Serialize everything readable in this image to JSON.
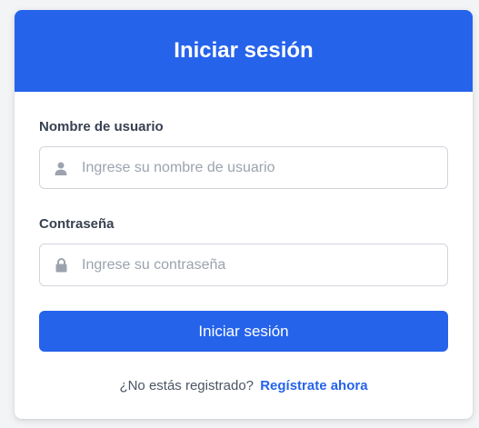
{
  "header": {
    "title": "Iniciar sesión"
  },
  "username": {
    "label": "Nombre de usuario",
    "placeholder": "Ingrese su nombre de usuario",
    "value": "",
    "icon": "user-icon"
  },
  "password": {
    "label": "Contraseña",
    "placeholder": "Ingrese su contraseña",
    "value": "",
    "icon": "lock-icon"
  },
  "submit": {
    "label": "Iniciar sesión"
  },
  "register": {
    "prompt": "¿No estás registrado?",
    "link_label": "Regístrate ahora"
  },
  "colors": {
    "accent": "#2563eb",
    "icon": "#9ca3af",
    "label": "#374151",
    "muted_text": "#4b5563"
  }
}
